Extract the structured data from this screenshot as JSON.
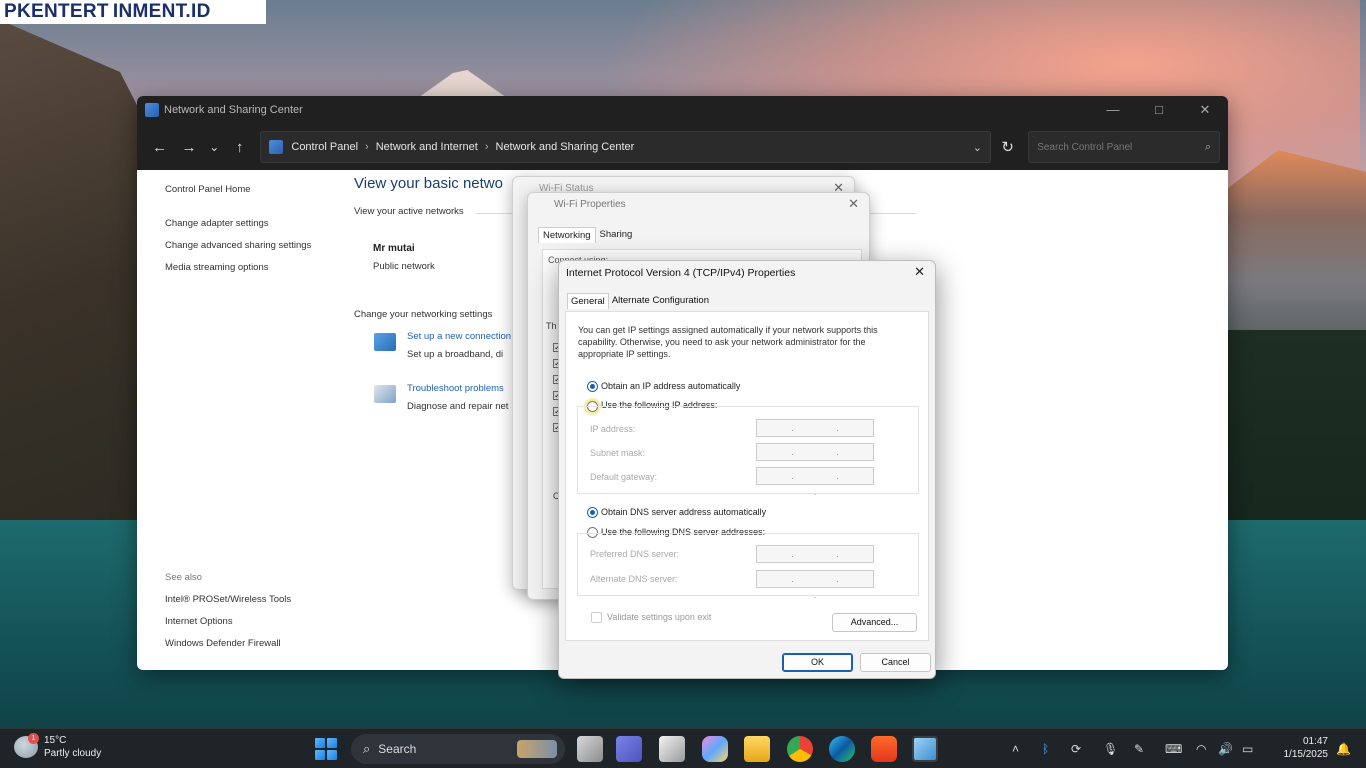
{
  "watermark": "PKENTERT INMENT.ID",
  "window": {
    "title": "Network and Sharing Center",
    "controls": {
      "minimize": "—",
      "maximize": "□",
      "close": "✕"
    }
  },
  "addressbar": {
    "back": "←",
    "forward": "→",
    "recent": "⌄",
    "up": "↑",
    "breadcrumb": [
      "Control Panel",
      "Network and Internet",
      "Network and Sharing Center"
    ],
    "separator": "›",
    "dropdown": "⌄",
    "refresh": "↻",
    "search_placeholder": "Search Control Panel",
    "search_icon": "⌕"
  },
  "left_pane": {
    "home": "Control Panel Home",
    "links": [
      "Change adapter settings",
      "Change advanced sharing settings",
      "Media streaming options"
    ],
    "see_also_label": "See also",
    "see_also": [
      "Intel® PROSet/Wireless Tools",
      "Internet Options",
      "Windows Defender Firewall"
    ]
  },
  "main_pane": {
    "heading": "View your basic netwo",
    "active_networks": "View your active networks",
    "network_name": "Mr mutai",
    "network_type": "Public network",
    "change_settings": "Change your networking settings",
    "tasks": [
      {
        "icon": "network-setup-icon",
        "link": "Set up a new connection",
        "desc": "Set up a broadband, di"
      },
      {
        "icon": "troubleshoot-icon",
        "link": "Troubleshoot problems",
        "desc": "Diagnose and repair net"
      }
    ]
  },
  "wifi_status": {
    "title": "Wi-Fi Status",
    "close": "✕"
  },
  "wifi_properties": {
    "title": "Wi-Fi Properties",
    "close": "✕",
    "tabs": [
      "Networking",
      "Sharing"
    ],
    "connect_using": "Connect using:",
    "this_connection": "Th",
    "letter": "C"
  },
  "ipv4": {
    "title": "Internet Protocol Version 4 (TCP/IPv4) Properties",
    "close": "✕",
    "tabs": [
      "General",
      "Alternate Configuration"
    ],
    "description": "You can get IP settings assigned automatically if your network supports this capability. Otherwise, you need to ask your network administrator for the appropriate IP settings.",
    "ip_auto": {
      "label": "Obtain an IP address automatically",
      "selected": true
    },
    "ip_manual": {
      "label": "Use the following IP address:",
      "selected": false
    },
    "ip_fields": [
      {
        "label": "IP address:",
        "value": ". . ."
      },
      {
        "label": "Subnet mask:",
        "value": ". . ."
      },
      {
        "label": "Default gateway:",
        "value": ". . ."
      }
    ],
    "dns_auto": {
      "label": "Obtain DNS server address automatically",
      "selected": true
    },
    "dns_manual": {
      "label": "Use the following DNS server addresses:",
      "selected": false
    },
    "dns_fields": [
      {
        "label": "Preferred DNS server:",
        "value": ". . ."
      },
      {
        "label": "Alternate DNS server:",
        "value": ". . ."
      }
    ],
    "validate": {
      "label": "Validate settings upon exit",
      "checked": false
    },
    "advanced": "Advanced...",
    "ok": "OK",
    "cancel": "Cancel"
  },
  "taskbar": {
    "weather": {
      "temp": "15°C",
      "condition": "Partly cloudy",
      "badge": "1"
    },
    "search": "Search",
    "search_icon": "⌕",
    "apps": [
      "file-explorer-icon",
      "teams-icon",
      "store-icon",
      "copilot-icon",
      "folder-icon",
      "chrome-icon",
      "edge-icon",
      "brave-icon",
      "remote-desktop-icon"
    ],
    "tray": {
      "chevron": "˄"
    },
    "time": "01:47",
    "date": "1/15/2025"
  },
  "colors": {
    "accent": "#1a5fb4",
    "link": "#2062b8",
    "titlebar": "#202020",
    "taskbar": "#1f2428"
  }
}
